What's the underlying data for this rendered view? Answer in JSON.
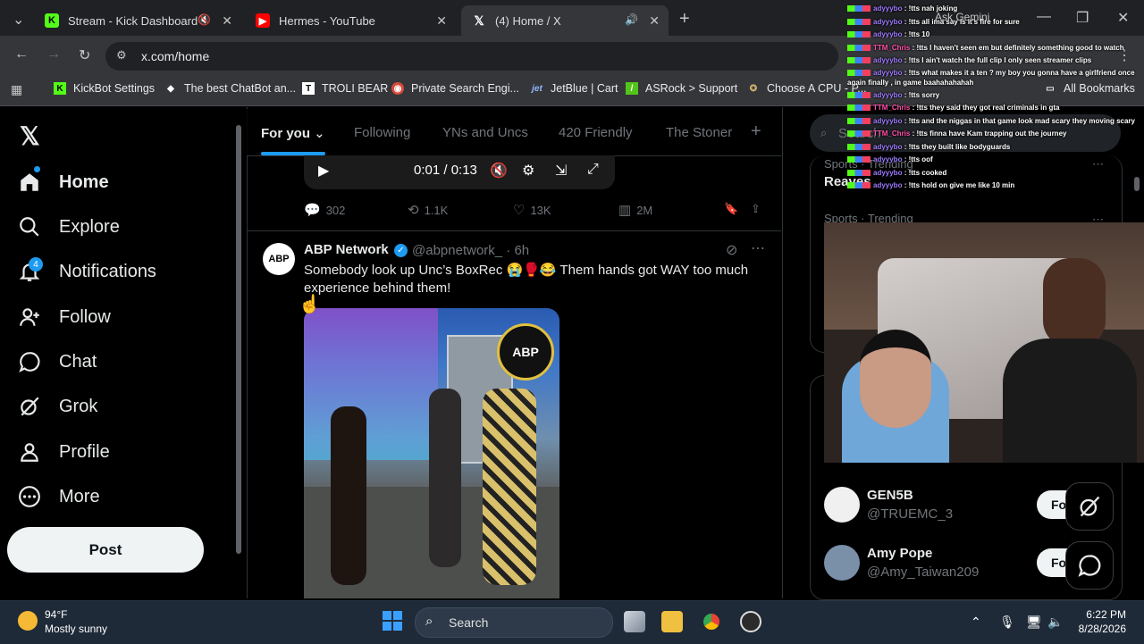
{
  "browser": {
    "tabs": [
      {
        "title": "Stream - Kick Dashboard"
      },
      {
        "title": "Hermes - YouTube"
      },
      {
        "title": "(4) Home / X"
      }
    ],
    "url": "x.com/home",
    "bookmarks": [
      "KickBot Settings",
      "The best ChatBot an...",
      "TROLI BEAR",
      "Private Search Engi...",
      "JetBlue | Cart",
      "ASRock > Support",
      "Choose A CPU - P...",
      "All Bookmarks"
    ]
  },
  "nav": {
    "items": [
      "Home",
      "Explore",
      "Notifications",
      "Follow",
      "Chat",
      "Grok",
      "Profile",
      "More"
    ],
    "notif_count": "4",
    "post_label": "Post"
  },
  "feed": {
    "tabs": [
      "For you",
      "Following",
      "YNs and Uncs",
      "420 Friendly",
      "The Stoner"
    ],
    "video_time": "0:01 / 0:13",
    "prev_actions": {
      "replies": "302",
      "reposts": "1.1K",
      "likes": "13K",
      "views": "2M"
    },
    "tweet": {
      "author": "ABP Network",
      "handle": "@abpnetwork_ · 6h",
      "text": "Somebody look up Unc’s BoxRec 😭🥊😂 Them hands got WAY too much experience behind them!",
      "badge": "ABP"
    }
  },
  "right": {
    "search_placeholder": "Search",
    "trend1_category": "Sports · Trending",
    "trend1_title": "Reaves",
    "trend2_category": "Sports · Trending",
    "follow": [
      {
        "name": "GEN5B",
        "handle": "@TRUEMC_3",
        "button": "Fo"
      },
      {
        "name": "Amy Pope",
        "handle": "@Amy_Taiwan209",
        "button": "Fo"
      }
    ]
  },
  "chat": {
    "lines": [
      {
        "user": "adyyybo",
        "msg": "!tts nah joking"
      },
      {
        "user": "adyyybo",
        "msg": "!tts all ima say is it's fire for sure"
      },
      {
        "user": "adyyybo",
        "msg": "!tts 10"
      },
      {
        "user": "TTM_Chris",
        "msg": "!tts I haven't seen em but definitely something good to watch"
      },
      {
        "user": "adyyybo",
        "msg": "!tts I ain't watch the full clip I only seen streamer clips"
      },
      {
        "user": "adyyybo",
        "msg": "!tts what makes it a ten ? my boy you gonna have a girlfriend once again finally , in game baahahahahah"
      },
      {
        "user": "adyyybo",
        "msg": "!tts sorry"
      },
      {
        "user": "TTM_Chris",
        "msg": "!tts they said they got real criminals in gta"
      },
      {
        "user": "adyyybo",
        "msg": "!tts and the niggas in that game look mad scary they moving scary"
      },
      {
        "user": "TTM_Chris",
        "msg": "!tts finna have Kam trapping out the journey"
      },
      {
        "user": "adyyybo",
        "msg": "!tts they built like bodyguards"
      },
      {
        "user": "adyyybo",
        "msg": "!tts oof"
      },
      {
        "user": "adyyybo",
        "msg": "!tts cooked"
      },
      {
        "user": "adyyybo",
        "msg": "!tts hold on give me like 10 min"
      }
    ],
    "ask_gemini": "Ask Gemini"
  },
  "taskbar": {
    "temp": "94°F",
    "condition": "Mostly sunny",
    "search": "Search",
    "time": "6:22 PM",
    "date": "8/28/2026"
  }
}
